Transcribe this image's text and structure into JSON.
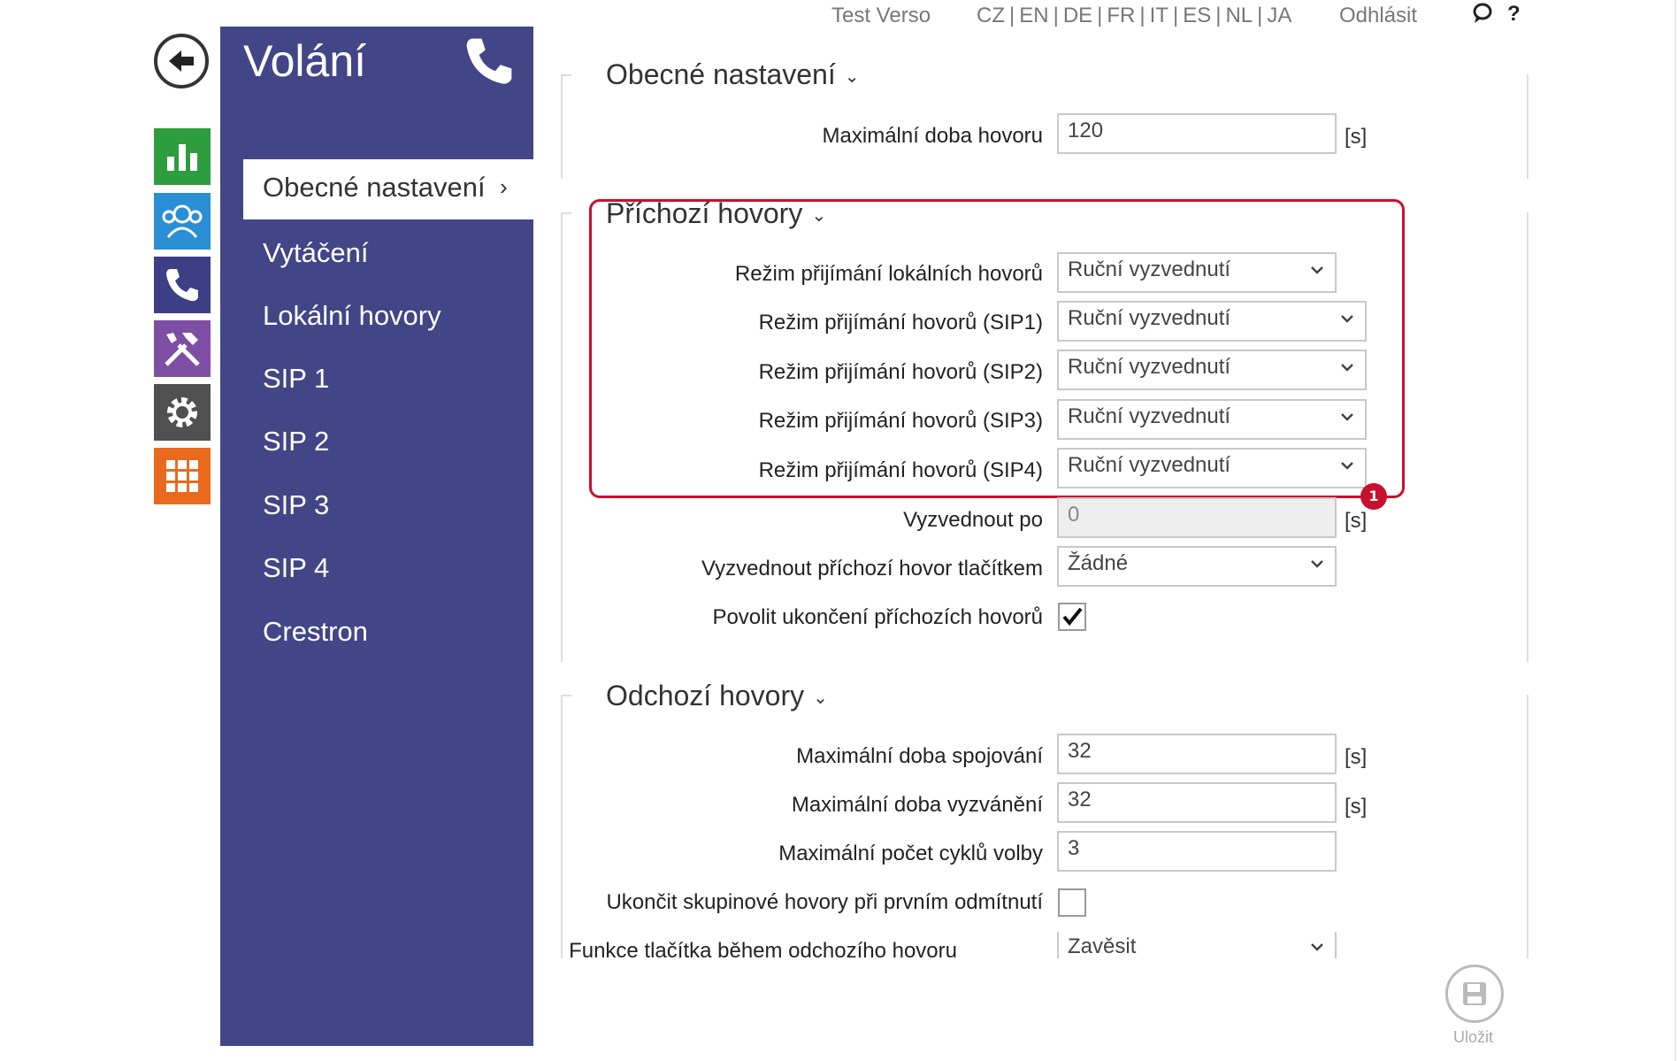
{
  "topbar": {
    "user": "Test Verso",
    "languages": [
      "CZ",
      "EN",
      "DE",
      "FR",
      "IT",
      "ES",
      "NL",
      "JA"
    ],
    "logout": "Odhlásit",
    "help": "?"
  },
  "panel": {
    "title": "Volání",
    "nav": [
      {
        "label": "Obecné nastavení",
        "active": true
      },
      {
        "label": "Vytáčení"
      },
      {
        "label": "Lokální hovory"
      },
      {
        "label": "SIP 1"
      },
      {
        "label": "SIP 2"
      },
      {
        "label": "SIP 3"
      },
      {
        "label": "SIP 4"
      },
      {
        "label": "Crestron"
      }
    ]
  },
  "tiles": {
    "colors": [
      "#2e9d3e",
      "#2a8fd4",
      "#3c3f86",
      "#7d4ea3",
      "#505050",
      "#e96a1e"
    ],
    "icons": [
      "chart-icon",
      "users-icon",
      "phone-icon",
      "tools-icon",
      "gear-icon",
      "grid-icon"
    ]
  },
  "general": {
    "heading": "Obecné nastavení",
    "max_call_label": "Maximální doba hovoru",
    "max_call_value": "120",
    "unit": "[s]"
  },
  "incoming": {
    "heading": "Příchozí hovory",
    "mode_local_label": "Režim přijímání lokálních hovorů",
    "mode_sip1_label": "Režim přijímání hovorů (SIP1)",
    "mode_sip2_label": "Režim přijímání hovorů (SIP2)",
    "mode_sip3_label": "Režim přijímání hovorů (SIP3)",
    "mode_sip4_label": "Režim přijímání hovorů (SIP4)",
    "mode_value": "Ruční vyzvednutí",
    "pickup_after_label": "Vyzvednout po",
    "pickup_after_value": "0",
    "pickup_button_label": "Vyzvednout příchozí hovor tlačítkem",
    "pickup_button_value": "Žádné",
    "allow_end_label": "Povolit ukončení příchozích hovorů",
    "allow_end_checked": true,
    "badge": "1"
  },
  "outgoing": {
    "heading": "Odchozí hovory",
    "max_connect_label": "Maximální doba spojování",
    "max_connect_value": "32",
    "max_ring_label": "Maximální doba vyzvánění",
    "max_ring_value": "32",
    "max_cycles_label": "Maximální počet cyklů volby",
    "max_cycles_value": "3",
    "end_group_label": "Ukončit skupinové hovory při prvním odmítnutí",
    "button_func_label": "Funkce tlačítka během odchozího hovoru",
    "button_func_value": "Zavěsit"
  },
  "save_label": "Uložit",
  "accent_color": "#424687",
  "highlight_color": "#c8102e"
}
